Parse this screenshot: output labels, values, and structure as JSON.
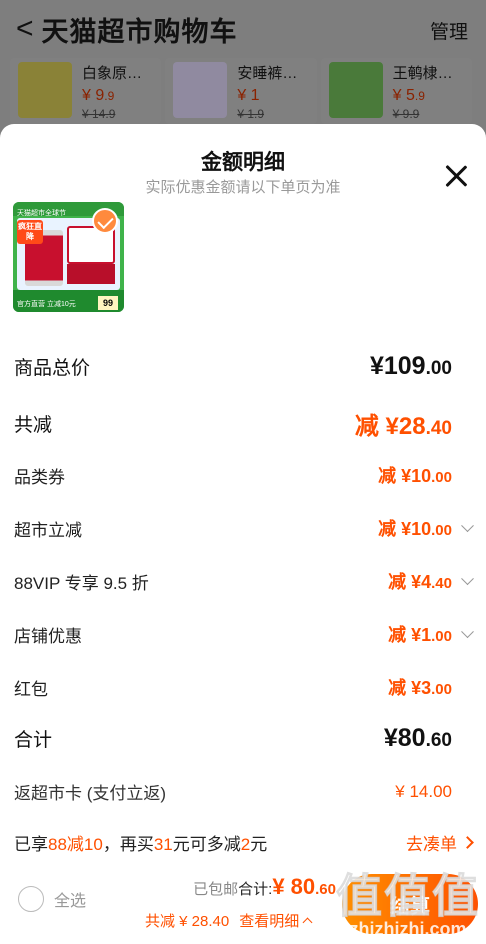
{
  "header": {
    "back_glyph": "<",
    "title": "天猫超市购物车",
    "manage": "管理"
  },
  "bg_products": [
    {
      "name": "白象原…",
      "price": "¥ 9",
      "price_dec": ".9",
      "orig": "¥ 14.9",
      "color": "#c8b548"
    },
    {
      "name": "安睡裤…",
      "price": "¥ 1",
      "price_dec": "",
      "orig": "¥ 1.9",
      "color": "#b7a9c8"
    },
    {
      "name": "王鹌棣…",
      "price": "¥ 5",
      "price_dec": ".9",
      "orig": "¥ 9.9",
      "color": "#6aa84f"
    }
  ],
  "sheet": {
    "title": "金额明细",
    "subtitle": "实际优惠金额请以下单页为准",
    "product": {
      "promo": "疯狂直降",
      "count": "99",
      "top_text": "天猫超市全球节",
      "bottom_text": "官方直营 立减10元"
    }
  },
  "rows": {
    "total_price": {
      "label": "商品总价",
      "int": "¥109",
      "dec": ".00"
    },
    "total_cut": {
      "label": "共减",
      "int": "减 ¥28",
      "dec": ".40"
    },
    "category_coupon": {
      "label": "品类券",
      "int": "减 ¥10",
      "dec": ".00"
    },
    "market_cut": {
      "label": "超市立减",
      "int": "减 ¥10",
      "dec": ".00"
    },
    "vip": {
      "label": "88VIP 专享 9.5 折",
      "int": "减 ¥4",
      "dec": ".40"
    },
    "store_discount": {
      "label": "店铺优惠",
      "int": "减 ¥1",
      "dec": ".00"
    },
    "red_packet": {
      "label": "红包",
      "int": "减 ¥3",
      "dec": ".00"
    },
    "subtotal": {
      "label": "合计",
      "int": "¥80",
      "dec": ".60"
    },
    "cashback": {
      "label": "返超市卡 (支付立返)",
      "amount": "¥ 14.00"
    }
  },
  "promo": {
    "p1": "已享",
    "p2": "88减10",
    "p3": "，再买",
    "p4": "31",
    "p5": "元可多减",
    "p6": "2",
    "p7": "元",
    "link": "去凑单"
  },
  "bottom": {
    "select_all": "全选",
    "free_shipping": "已包邮",
    "total_label": "合计: ",
    "total_int": "¥ 80",
    "total_dec": ".60",
    "cut_text": "共减 ¥ 28.40",
    "detail_link": "查看明细",
    "checkout": "结算"
  },
  "watermark": {
    "logo": "值值值",
    "url": "zhizhizhi.com"
  },
  "colors": {
    "accent": "#ff5000",
    "overlay": "#7f7f7f"
  }
}
